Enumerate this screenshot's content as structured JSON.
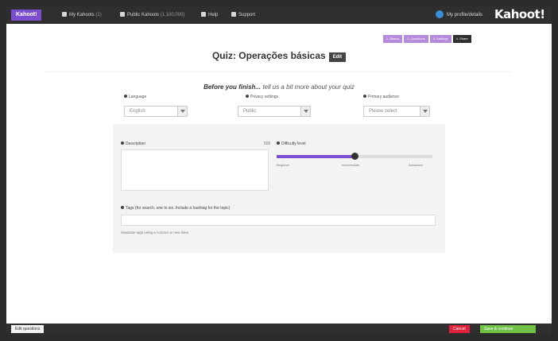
{
  "nav": {
    "brand": "Kahoot!",
    "items": [
      {
        "icon": "user-icon",
        "label": "My Kahoots",
        "sub": "(1)"
      },
      {
        "icon": "users-icon",
        "label": "Public Kahoots",
        "sub": "(1,100,000)"
      },
      {
        "icon": "help-icon",
        "label": "Help"
      },
      {
        "icon": "megaphone-icon",
        "label": "Support"
      }
    ],
    "profile": "My profile/details",
    "logo": "Kahoot!"
  },
  "steps": [
    {
      "label": "1. Basics",
      "active": false
    },
    {
      "label": "2. Questions",
      "active": false
    },
    {
      "label": "3. Settings",
      "active": false
    },
    {
      "label": "4. Share",
      "active": true
    }
  ],
  "title": "Quiz: Operações básicas",
  "edit_label": "Edit",
  "subtitle_bold": "Before you finish...",
  "subtitle_rest": "tell us a bit more about your quiz",
  "fields": {
    "language": {
      "label": "Language",
      "value": "English"
    },
    "privacy": {
      "label": "Privacy settings",
      "value": "Public"
    },
    "audience": {
      "label": "Primary audience",
      "value": "Please select"
    }
  },
  "description": {
    "label": "Description",
    "count": "500"
  },
  "difficulty": {
    "label": "Difficulty level",
    "ticks": [
      "Beginner",
      "Intermediate",
      "Advanced"
    ],
    "level": 0.5
  },
  "tags": {
    "label": "Tags (for search, one to six. Include a hashtag for the topic)",
    "hint": "Separate tags using a comma or new lines"
  },
  "bottom": {
    "back": "Edit questions",
    "red": "Cancel",
    "green": "Save & continue"
  },
  "colors": {
    "accent": "#7b4fcf",
    "dark": "#2f2f2f",
    "danger": "#e0223d",
    "success": "#6fc245"
  }
}
